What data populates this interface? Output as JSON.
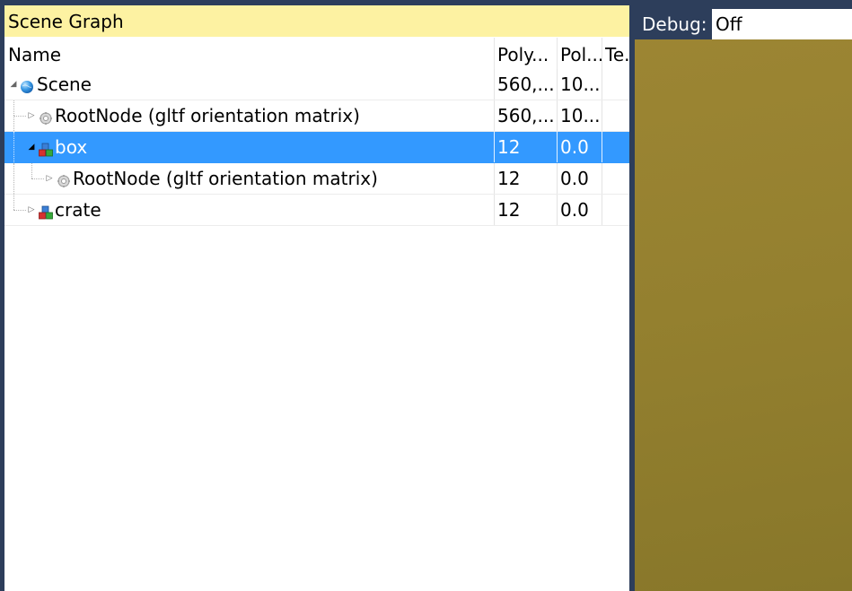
{
  "scene_graph": {
    "title": "Scene Graph",
    "columns": [
      "Name",
      "Poly...",
      "Pol...",
      "Te..."
    ],
    "rows": [
      {
        "name": "Scene",
        "col1": "560,...",
        "col2": "10...",
        "col3": "",
        "icon": "globe-icon",
        "expander": "expanded",
        "selected": false
      },
      {
        "name": "RootNode (gltf orientation matrix)",
        "col1": "560,...",
        "col2": "10...",
        "col3": "",
        "icon": "gear-node-icon",
        "expander": "collapsed",
        "selected": false
      },
      {
        "name": "box",
        "col1": "12",
        "col2": "0.0",
        "col3": "",
        "icon": "cubes-icon",
        "expander": "expanded",
        "selected": true
      },
      {
        "name": "RootNode (gltf orientation matrix)",
        "col1": "12",
        "col2": "0.0",
        "col3": "",
        "icon": "gear-node-icon",
        "expander": "collapsed",
        "selected": false
      },
      {
        "name": "crate",
        "col1": "12",
        "col2": "0.0",
        "col3": "",
        "icon": "cubes-icon",
        "expander": "collapsed",
        "selected": false
      }
    ]
  },
  "viewport": {
    "debug_label": "Debug:",
    "debug_value": "Off",
    "background_color": "#94802f"
  },
  "colors": {
    "frame": "#2d3e5b",
    "title_bar": "#fdf2a2",
    "selection": "#3399ff"
  }
}
